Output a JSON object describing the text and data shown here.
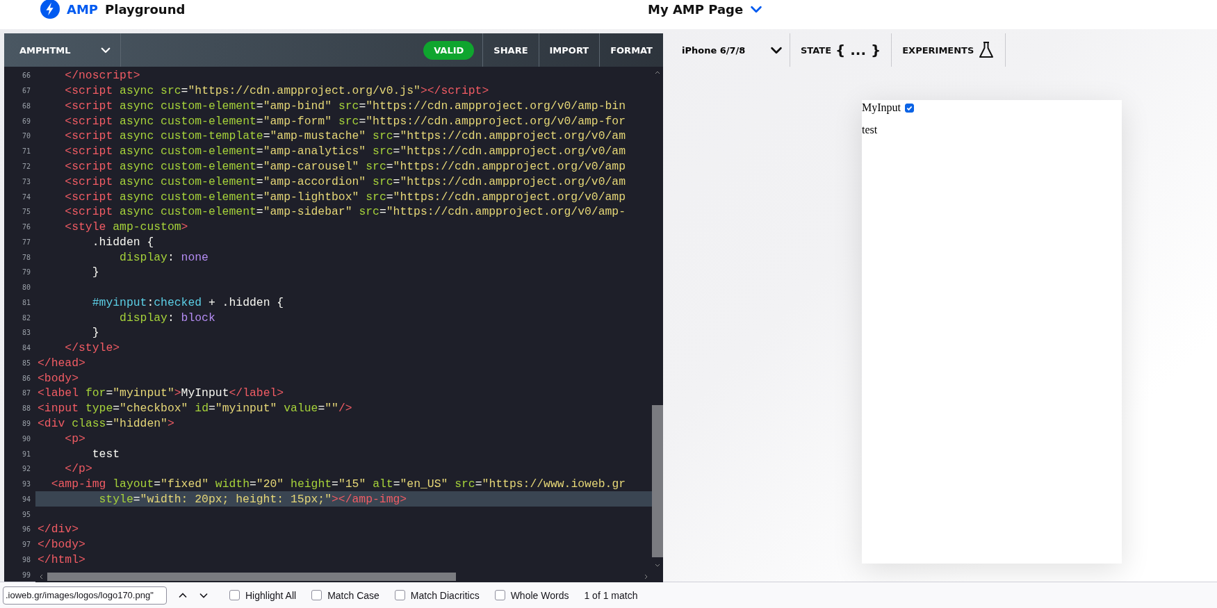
{
  "header": {
    "brand_accent": "AMP",
    "brand_name": "Playground",
    "document_title": "My AMP Page"
  },
  "editor": {
    "format": "AMPHTML",
    "status": "VALID",
    "actions": [
      "SHARE",
      "IMPORT",
      "FORMAT"
    ],
    "lines": [
      {
        "number": "66",
        "highlighted": false,
        "kind": "markup",
        "text": "    </noscript>"
      },
      {
        "number": "67",
        "highlighted": false,
        "kind": "markup",
        "text": "    <script async src=\"https://cdn.ampproject.org/v0.js\"></script>"
      },
      {
        "number": "68",
        "highlighted": false,
        "kind": "markup",
        "text": "    <script async custom-element=\"amp-bind\" src=\"https://cdn.ampproject.org/v0/amp-bin"
      },
      {
        "number": "69",
        "highlighted": false,
        "kind": "markup",
        "text": "    <script async custom-element=\"amp-form\" src=\"https://cdn.ampproject.org/v0/amp-for"
      },
      {
        "number": "70",
        "highlighted": false,
        "kind": "markup",
        "text": "    <script async custom-template=\"amp-mustache\" src=\"https://cdn.ampproject.org/v0/am"
      },
      {
        "number": "71",
        "highlighted": false,
        "kind": "markup",
        "text": "    <script async custom-element=\"amp-analytics\" src=\"https://cdn.ampproject.org/v0/am"
      },
      {
        "number": "72",
        "highlighted": false,
        "kind": "markup",
        "text": "    <script async custom-element=\"amp-carousel\" src=\"https://cdn.ampproject.org/v0/amp"
      },
      {
        "number": "73",
        "highlighted": false,
        "kind": "markup",
        "text": "    <script async custom-element=\"amp-accordion\" src=\"https://cdn.ampproject.org/v0/am"
      },
      {
        "number": "74",
        "highlighted": false,
        "kind": "markup",
        "text": "    <script async custom-element=\"amp-lightbox\" src=\"https://cdn.ampproject.org/v0/amp"
      },
      {
        "number": "75",
        "highlighted": false,
        "kind": "markup",
        "text": "    <script async custom-element=\"amp-sidebar\" src=\"https://cdn.ampproject.org/v0/amp-"
      },
      {
        "number": "76",
        "highlighted": false,
        "kind": "markup",
        "text": "    <style amp-custom>"
      },
      {
        "number": "77",
        "highlighted": false,
        "kind": "style",
        "text": "        .hidden {"
      },
      {
        "number": "78",
        "highlighted": false,
        "kind": "style",
        "text": "            display: none"
      },
      {
        "number": "79",
        "highlighted": false,
        "kind": "style",
        "text": "        }"
      },
      {
        "number": "80",
        "highlighted": false
      },
      {
        "number": "81",
        "highlighted": false,
        "kind": "style",
        "text": "        #myinput:checked + .hidden {"
      },
      {
        "number": "82",
        "highlighted": false,
        "kind": "style",
        "text": "            display: block"
      },
      {
        "number": "83",
        "highlighted": false,
        "kind": "style",
        "text": "        }"
      },
      {
        "number": "84",
        "highlighted": false,
        "kind": "markup",
        "text": "    </style>"
      },
      {
        "number": "85",
        "highlighted": false,
        "kind": "markup",
        "text": "</head>"
      },
      {
        "number": "86",
        "highlighted": false,
        "kind": "markup",
        "text": "<body>"
      },
      {
        "number": "87",
        "highlighted": false,
        "kind": "markup",
        "text": "<label for=\"myinput\">MyInput</label>"
      },
      {
        "number": "88",
        "highlighted": false,
        "kind": "markup",
        "text": "<input type=\"checkbox\" id=\"myinput\" value=\"\"/>"
      },
      {
        "number": "89",
        "highlighted": false,
        "kind": "markup",
        "text": "<div class=\"hidden\">"
      },
      {
        "number": "90",
        "highlighted": false,
        "kind": "markup",
        "text": "    <p>"
      },
      {
        "number": "91",
        "highlighted": false,
        "kind": "markup",
        "text": "        test"
      },
      {
        "number": "92",
        "highlighted": false,
        "kind": "markup",
        "text": "    </p>"
      },
      {
        "number": "93",
        "highlighted": false,
        "kind": "markup",
        "text": "  <amp-img layout=\"fixed\" width=\"20\" height=\"15\" alt=\"en_US\" src=\"https://www.ioweb.gr"
      },
      {
        "number": "94",
        "highlighted": true,
        "kind": "markup",
        "text": "         style=\"width: 20px; height: 15px;\"></amp-img>"
      },
      {
        "number": "95",
        "highlighted": false
      },
      {
        "number": "96",
        "highlighted": false,
        "kind": "markup",
        "text": "</div>"
      },
      {
        "number": "97",
        "highlighted": false,
        "kind": "markup",
        "text": "</body>"
      },
      {
        "number": "98",
        "highlighted": false,
        "kind": "markup",
        "text": "</html>"
      },
      {
        "number": "99",
        "highlighted": false
      }
    ]
  },
  "preview": {
    "device": "iPhone 6/7/8",
    "state_label": "STATE",
    "state_braces": "{ ... }",
    "experiments": "EXPERIMENTS",
    "page": {
      "label": "MyInput",
      "checked": true,
      "text": "test"
    }
  },
  "find_bar": {
    "value": ".ioweb.gr/images/logos/logo170.png\"",
    "options": [
      {
        "label": "Highlight All",
        "checked": false
      },
      {
        "label": "Match Case",
        "checked": false
      },
      {
        "label": "Match Diacritics",
        "checked": false
      },
      {
        "label": "Whole Words",
        "checked": false
      }
    ],
    "result": "1 of 1 match"
  }
}
